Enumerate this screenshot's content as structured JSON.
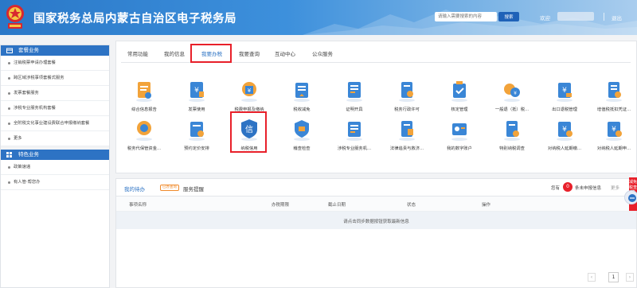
{
  "header": {
    "site_title": "国家税务总局内蒙古自治区电子税务局",
    "search_placeholder": "请输入需要搜索的内容",
    "search_button": "搜索",
    "welcome": "欢迎",
    "logout": "退出"
  },
  "sidebar": {
    "groups": [
      {
        "title": "套餐业务",
        "items": [
          "注销税票申请办理套餐",
          "跨区域涉税事项套餐式服务",
          "发票套餐服务",
          "涉税专业服务机构套餐",
          "全附税文化事业建设费联合申报缴纳套餐",
          "更多"
        ]
      },
      {
        "title": "特色业务",
        "items": [
          "政策速递",
          "有人管·帮您办"
        ]
      }
    ]
  },
  "main": {
    "tabs": [
      "常用功能",
      "我的信息",
      "我要办税",
      "我要查询",
      "互动中心",
      "公众服务"
    ],
    "active_tab": "我要办税",
    "tiles_row1": [
      "综合信息报告",
      "发票使用",
      "税费申报及缴纳",
      "税收减免",
      "证明开具",
      "税务行政许可",
      "核定管理",
      "一般退（抵）税...",
      "出口退税管理",
      "增值税抵扣凭证..."
    ],
    "tiles_row2": [
      "税务代保管资金...",
      "预约定价安排",
      "纳税信用",
      "稽查检查",
      "涉税专业服务机...",
      "法律追责与救济...",
      "我的数字账户",
      "特别纳税调查",
      "对纳税人延期缴...",
      "对纳税人延期申..."
    ]
  },
  "todo": {
    "tabs": [
      "我的待办",
      "服务提醒"
    ],
    "badge": "已办查询",
    "pending_prefix": "您有",
    "pending_count": "0",
    "pending_suffix": "条未申报信息",
    "more": "更多",
    "columns": [
      "事项名称",
      "办税期限",
      "截止日期",
      "状态",
      "操作"
    ],
    "empty_message": "请点击同步数据按钮获取最新信息",
    "page_number": "1"
  },
  "float_tab": "减免税查询",
  "colors": {
    "primary": "#2d73c4",
    "highlight": "#e8202a",
    "accent_orange": "#f08a2b"
  },
  "icons": {
    "tiles_row1": [
      "report-icon",
      "invoice-icon",
      "tax-declare-icon",
      "tax-reduction-icon",
      "certificate-icon",
      "permit-icon",
      "verification-icon",
      "refund-icon",
      "export-refund-icon",
      "vat-deduction-icon"
    ],
    "tiles_row2": [
      "custody-fund-icon",
      "pricing-icon",
      "credit-icon",
      "inspection-icon",
      "agency-icon",
      "legal-icon",
      "digital-account-icon",
      "special-investigation-icon",
      "deferred-payment-icon",
      "deferred-declare-icon"
    ]
  }
}
